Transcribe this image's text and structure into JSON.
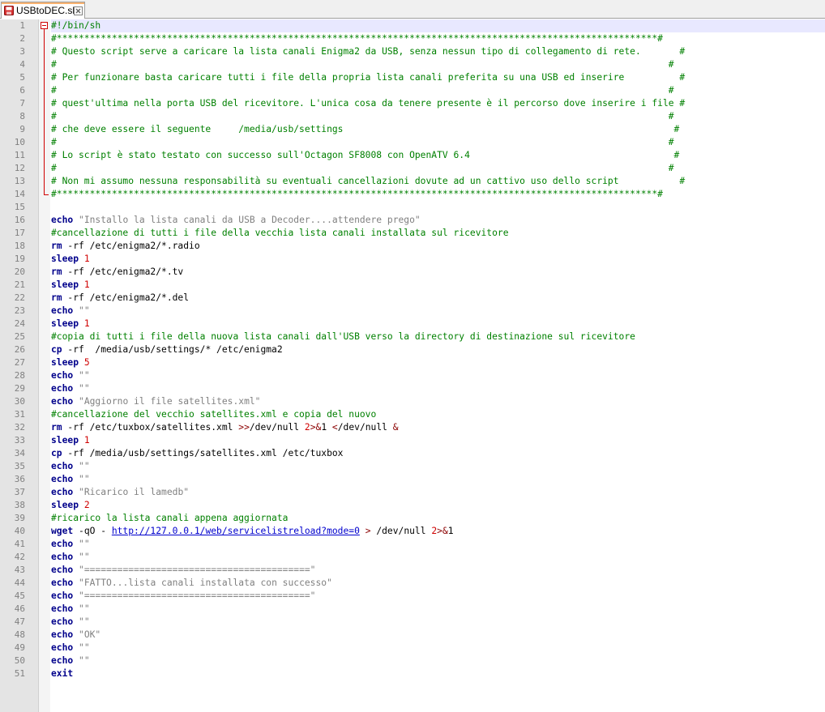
{
  "tab": {
    "title": "USBtoDEC.sh",
    "save_icon": "save-icon",
    "close_icon": "close-icon"
  },
  "editor": {
    "current_line": 1,
    "lines": [
      [
        {
          "t": "#!/bin/sh",
          "c": "cmt"
        }
      ],
      [
        {
          "t": "#*************************************************************************************************************#",
          "c": "cmt"
        }
      ],
      [
        {
          "t": "# Questo script serve a caricare la lista canali Enigma2 da USB, senza nessun tipo di collegamento di rete.       #",
          "c": "cmt"
        }
      ],
      [
        {
          "t": "#                                                                                                               #",
          "c": "cmt"
        }
      ],
      [
        {
          "t": "# Per funzionare basta caricare tutti i file della propria lista canali preferita su una USB ed inserire          #",
          "c": "cmt"
        }
      ],
      [
        {
          "t": "#                                                                                                               #",
          "c": "cmt"
        }
      ],
      [
        {
          "t": "# quest'ultima nella porta USB del ricevitore. L'unica cosa da tenere presente è il percorso dove inserire i file #",
          "c": "cmt"
        }
      ],
      [
        {
          "t": "#                                                                                                               #",
          "c": "cmt"
        }
      ],
      [
        {
          "t": "# che deve essere il seguente     /media/usb/settings                                                            #",
          "c": "cmt"
        }
      ],
      [
        {
          "t": "#                                                                                                               #",
          "c": "cmt"
        }
      ],
      [
        {
          "t": "# Lo script è stato testato con successo sull'Octagon SF8008 con OpenATV 6.4                                     #",
          "c": "cmt"
        }
      ],
      [
        {
          "t": "#                                                                                                               #",
          "c": "cmt"
        }
      ],
      [
        {
          "t": "# Non mi assumo nessuna responsabilità su eventuali cancellazioni dovute ad un cattivo uso dello script           #",
          "c": "cmt"
        }
      ],
      [
        {
          "t": "#*************************************************************************************************************#",
          "c": "cmt"
        }
      ],
      [],
      [
        {
          "t": "echo",
          "c": "kw"
        },
        {
          "t": " "
        },
        {
          "t": "\"Installo la lista canali da USB a Decoder....attendere prego\"",
          "c": "str"
        }
      ],
      [
        {
          "t": "#cancellazione di tutti i file della vecchia lista canali installata sul ricevitore",
          "c": "cmt"
        }
      ],
      [
        {
          "t": "rm",
          "c": "kw"
        },
        {
          "t": " -rf /etc/enigma2/*.radio"
        }
      ],
      [
        {
          "t": "sleep",
          "c": "kw"
        },
        {
          "t": " "
        },
        {
          "t": "1",
          "c": "num"
        }
      ],
      [
        {
          "t": "rm",
          "c": "kw"
        },
        {
          "t": " -rf /etc/enigma2/*.tv"
        }
      ],
      [
        {
          "t": "sleep",
          "c": "kw"
        },
        {
          "t": " "
        },
        {
          "t": "1",
          "c": "num"
        }
      ],
      [
        {
          "t": "rm",
          "c": "kw"
        },
        {
          "t": " -rf /etc/enigma2/*.del"
        }
      ],
      [
        {
          "t": "echo",
          "c": "kw"
        },
        {
          "t": " "
        },
        {
          "t": "\"\"",
          "c": "str"
        }
      ],
      [
        {
          "t": "sleep",
          "c": "kw"
        },
        {
          "t": " "
        },
        {
          "t": "1",
          "c": "num"
        }
      ],
      [
        {
          "t": "#copia di tutti i file della nuova lista canali dall'USB verso la directory di destinazione sul ricevitore",
          "c": "cmt"
        }
      ],
      [
        {
          "t": "cp",
          "c": "kw"
        },
        {
          "t": " -rf  /media/usb/settings/* /etc/enigma2"
        }
      ],
      [
        {
          "t": "sleep",
          "c": "kw"
        },
        {
          "t": " "
        },
        {
          "t": "5",
          "c": "num"
        }
      ],
      [
        {
          "t": "echo",
          "c": "kw"
        },
        {
          "t": " "
        },
        {
          "t": "\"\"",
          "c": "str"
        }
      ],
      [
        {
          "t": "echo",
          "c": "kw"
        },
        {
          "t": " "
        },
        {
          "t": "\"\"",
          "c": "str"
        }
      ],
      [
        {
          "t": "echo",
          "c": "kw"
        },
        {
          "t": " "
        },
        {
          "t": "\"Aggiorno il file satellites.xml\"",
          "c": "str"
        }
      ],
      [
        {
          "t": "#cancellazione del vecchio satellites.xml e copia del nuovo",
          "c": "cmt"
        }
      ],
      [
        {
          "t": "rm",
          "c": "kw"
        },
        {
          "t": " -rf /etc/tuxbox/satellites.xml "
        },
        {
          "t": ">>",
          "c": "op"
        },
        {
          "t": "/dev/null "
        },
        {
          "t": "2",
          "c": "num"
        },
        {
          "t": ">&",
          "c": "op"
        },
        {
          "t": "1 "
        },
        {
          "t": "<",
          "c": "op"
        },
        {
          "t": "/dev/null "
        },
        {
          "t": "&",
          "c": "op"
        }
      ],
      [
        {
          "t": "sleep",
          "c": "kw"
        },
        {
          "t": " "
        },
        {
          "t": "1",
          "c": "num"
        }
      ],
      [
        {
          "t": "cp",
          "c": "kw"
        },
        {
          "t": " -rf /media/usb/settings/satellites.xml /etc/tuxbox"
        }
      ],
      [
        {
          "t": "echo",
          "c": "kw"
        },
        {
          "t": " "
        },
        {
          "t": "\"\"",
          "c": "str"
        }
      ],
      [
        {
          "t": "echo",
          "c": "kw"
        },
        {
          "t": " "
        },
        {
          "t": "\"\"",
          "c": "str"
        }
      ],
      [
        {
          "t": "echo",
          "c": "kw"
        },
        {
          "t": " "
        },
        {
          "t": "\"Ricarico il lamedb\"",
          "c": "str"
        }
      ],
      [
        {
          "t": "sleep",
          "c": "kw"
        },
        {
          "t": " "
        },
        {
          "t": "2",
          "c": "num"
        }
      ],
      [
        {
          "t": "#ricarico la lista canali appena aggiornata",
          "c": "cmt"
        }
      ],
      [
        {
          "t": "wget",
          "c": "kw"
        },
        {
          "t": " -qO - "
        },
        {
          "t": "http://127.0.0.1/web/servicelistreload?mode=0",
          "c": "url"
        },
        {
          "t": " "
        },
        {
          "t": ">",
          "c": "op"
        },
        {
          "t": " /dev/null "
        },
        {
          "t": "2",
          "c": "num"
        },
        {
          "t": ">&",
          "c": "op"
        },
        {
          "t": "1"
        }
      ],
      [
        {
          "t": "echo",
          "c": "kw"
        },
        {
          "t": " "
        },
        {
          "t": "\"\"",
          "c": "str"
        }
      ],
      [
        {
          "t": "echo",
          "c": "kw"
        },
        {
          "t": " "
        },
        {
          "t": "\"\"",
          "c": "str"
        }
      ],
      [
        {
          "t": "echo",
          "c": "kw"
        },
        {
          "t": " "
        },
        {
          "t": "\"=========================================\"",
          "c": "str"
        }
      ],
      [
        {
          "t": "echo",
          "c": "kw"
        },
        {
          "t": " "
        },
        {
          "t": "\"FATTO...lista canali installata con successo\"",
          "c": "str"
        }
      ],
      [
        {
          "t": "echo",
          "c": "kw"
        },
        {
          "t": " "
        },
        {
          "t": "\"=========================================\"",
          "c": "str"
        }
      ],
      [
        {
          "t": "echo",
          "c": "kw"
        },
        {
          "t": " "
        },
        {
          "t": "\"\"",
          "c": "str"
        }
      ],
      [
        {
          "t": "echo",
          "c": "kw"
        },
        {
          "t": " "
        },
        {
          "t": "\"\"",
          "c": "str"
        }
      ],
      [
        {
          "t": "echo",
          "c": "kw"
        },
        {
          "t": " "
        },
        {
          "t": "\"OK\"",
          "c": "str"
        }
      ],
      [
        {
          "t": "echo",
          "c": "kw"
        },
        {
          "t": " "
        },
        {
          "t": "\"\"",
          "c": "str"
        }
      ],
      [
        {
          "t": "echo",
          "c": "kw"
        },
        {
          "t": " "
        },
        {
          "t": "\"\"",
          "c": "str"
        }
      ],
      [
        {
          "t": "exit",
          "c": "kw"
        }
      ]
    ]
  }
}
